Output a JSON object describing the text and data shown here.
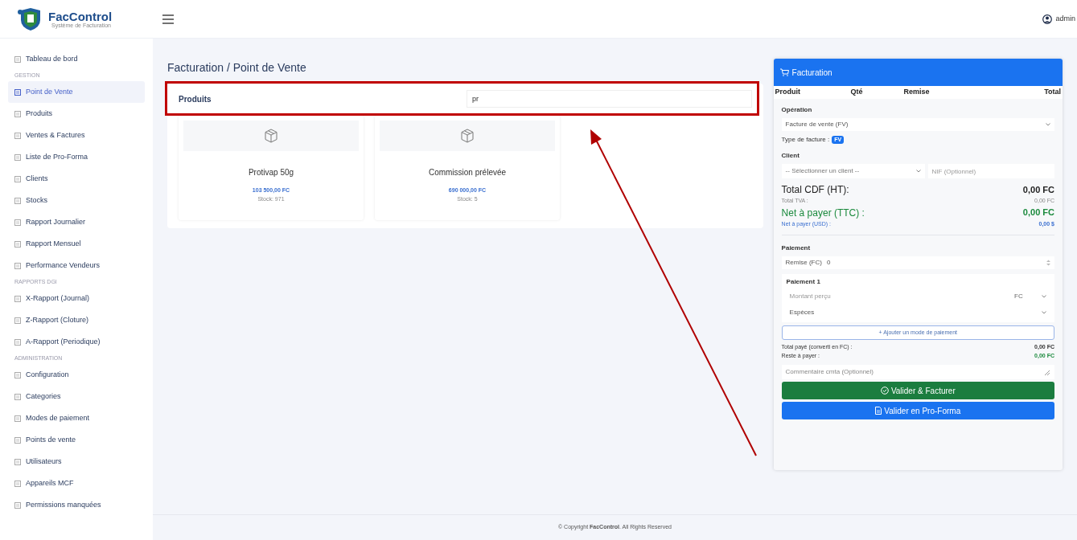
{
  "brand": {
    "name": "FacControl",
    "tagline": "Système de Facturation"
  },
  "topbar": {
    "user": "admin"
  },
  "sidebar": {
    "items": [
      {
        "kind": "link",
        "label": "Tableau de bord",
        "selected": false
      },
      {
        "kind": "section",
        "label": "GESTION"
      },
      {
        "kind": "link",
        "label": "Point de Vente",
        "selected": true
      },
      {
        "kind": "link",
        "label": "Produits",
        "selected": false
      },
      {
        "kind": "link",
        "label": "Ventes & Factures",
        "selected": false
      },
      {
        "kind": "link",
        "label": "Liste de Pro-Forma",
        "selected": false
      },
      {
        "kind": "link",
        "label": "Clients",
        "selected": false
      },
      {
        "kind": "link",
        "label": "Stocks",
        "selected": false
      },
      {
        "kind": "link",
        "label": "Rapport Journalier",
        "selected": false
      },
      {
        "kind": "link",
        "label": "Rapport Mensuel",
        "selected": false
      },
      {
        "kind": "link",
        "label": "Performance Vendeurs",
        "selected": false
      },
      {
        "kind": "section",
        "label": "RAPPORTS DGI"
      },
      {
        "kind": "link",
        "label": "X-Rapport (Journal)",
        "selected": false
      },
      {
        "kind": "link",
        "label": "Z-Rapport (Cloture)",
        "selected": false
      },
      {
        "kind": "link",
        "label": "A-Rapport (Periodique)",
        "selected": false
      },
      {
        "kind": "section",
        "label": "ADMINISTRATION"
      },
      {
        "kind": "link",
        "label": "Configuration",
        "selected": false
      },
      {
        "kind": "link",
        "label": "Categories",
        "selected": false
      },
      {
        "kind": "link",
        "label": "Modes de paiement",
        "selected": false
      },
      {
        "kind": "link",
        "label": "Points de vente",
        "selected": false
      },
      {
        "kind": "link",
        "label": "Utilisateurs",
        "selected": false
      },
      {
        "kind": "link",
        "label": "Appareils MCF",
        "selected": false
      },
      {
        "kind": "link",
        "label": "Permissions manquées",
        "selected": false
      }
    ]
  },
  "page_title": "Facturation / Point de Vente",
  "products": {
    "title": "Produits",
    "search": "pr",
    "items": [
      {
        "name": "Protivap 50g",
        "price": "103 500,00 FC",
        "stock": "Stock: 971"
      },
      {
        "name": "Commission prélevée",
        "price": "690 000,00 FC",
        "stock": "Stock: 5"
      }
    ]
  },
  "billing": {
    "title": "Facturation",
    "columns": [
      "Produit",
      "Qté",
      "Remise",
      "Total"
    ],
    "operation_label": "Opération",
    "operation": "Facture de vente (FV)",
    "invoice_type_label": "Type de facture :",
    "invoice_type": "FV",
    "client_label": "Client",
    "client_placeholder": "-- Sélectionner un client --",
    "nif_placeholder": "NIF (Optionnel)",
    "totals": [
      {
        "kind": "main",
        "label": "Total CDF (HT):",
        "value": "0,00 FC"
      },
      {
        "kind": "minor",
        "label": "Total TVA :",
        "value": "0,00 FC"
      },
      {
        "kind": "net",
        "label": "Net à payer (TTC) :",
        "value": "0,00 FC"
      },
      {
        "kind": "usd",
        "label": "Net à payer (USD) :",
        "value": "0,00 $"
      }
    ],
    "payment_label": "Paiement",
    "discount_label": "Remise (FC)",
    "discount": "0",
    "payment_title": "Paiement 1",
    "amount_placeholder": "Montant perçu",
    "currency": "FC",
    "method": "Espèces",
    "add_payment": "+ Ajouter un mode de paiement",
    "paid_label": "Total payé (converti en FC) :",
    "paid": "0,00 FC",
    "rest_label": "Reste à payer :",
    "rest": "0,00 FC",
    "comment_placeholder": "Commentaire cmta (Optionnel)",
    "validate": "Valider & Facturer",
    "proforma": "Valider en Pro-Forma"
  },
  "footer": {
    "text": "© Copyright **FacControl**. All Rights Reserved"
  }
}
